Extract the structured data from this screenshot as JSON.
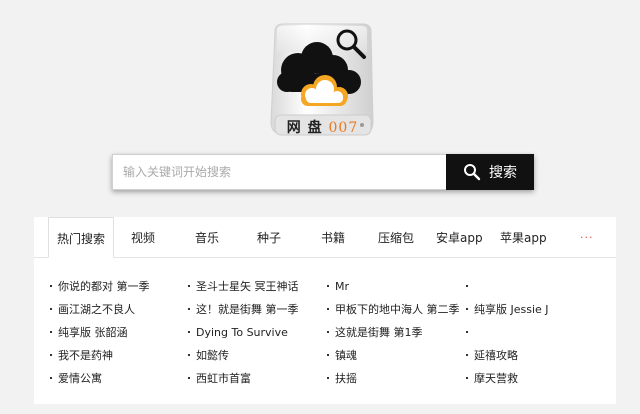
{
  "logo": {
    "text_cn": "网 盘",
    "text_num": "007"
  },
  "search": {
    "placeholder": "输入关键词开始搜索",
    "value": "",
    "button_label": "搜索"
  },
  "tabs": [
    {
      "label": "热门搜索"
    },
    {
      "label": "视频"
    },
    {
      "label": "音乐"
    },
    {
      "label": "种子"
    },
    {
      "label": "书籍"
    },
    {
      "label": "压缩包"
    },
    {
      "label": "安卓app"
    },
    {
      "label": "苹果app"
    },
    {
      "label": "···"
    }
  ],
  "columns": [
    [
      "你说的都对 第一季",
      "画江湖之不良人",
      "纯享版 张韶涵",
      "我不是药神",
      "爱情公寓"
    ],
    [
      "圣斗士星矢 冥王神话",
      "这！就是街舞 第一季",
      "Dying To Survive",
      "如懿传",
      "西虹市首富"
    ],
    [
      "Mr",
      "甲板下的地中海人 第二季",
      "这就是街舞 第1季",
      "镇魂",
      "扶摇"
    ],
    [
      "",
      "纯享版 Jessie J",
      "",
      "延禧攻略",
      "摩天营救"
    ]
  ],
  "colors": {
    "accent": "#e8771f",
    "button_bg": "#111111",
    "more": "#d9534f"
  },
  "icons": {
    "search_button": "search-icon",
    "logo": "cloud-drive-logo-icon"
  }
}
